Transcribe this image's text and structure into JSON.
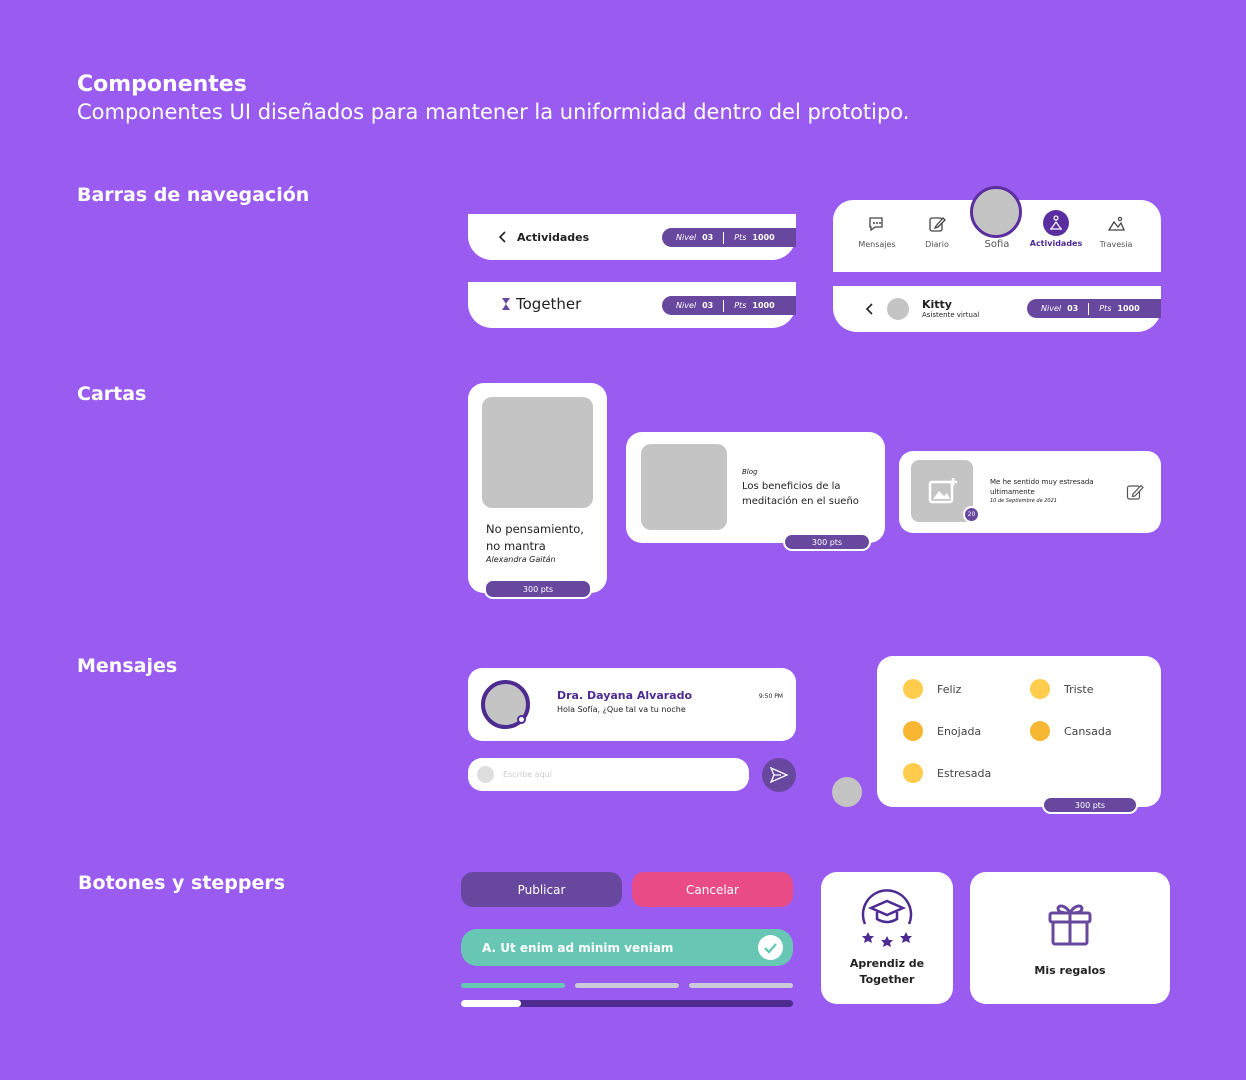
{
  "header": {
    "title": "Componentes",
    "subtitle": "Componentes UI diseñados para mantener la uniformidad dentro del prototipo."
  },
  "sections": {
    "nav": "Barras de navegación",
    "cards": "Cartas",
    "messages": "Mensajes",
    "buttons": "Botones y steppers"
  },
  "navbar_activities": {
    "title": "Actividades",
    "level_label": "Nivel",
    "level_value": "03",
    "pts_label": "Pts",
    "pts_value": "1000"
  },
  "navbar_together": {
    "title": "Together",
    "level_label": "Nivel",
    "level_value": "03",
    "pts_label": "Pts",
    "pts_value": "1000"
  },
  "tabbar": {
    "tabs": [
      {
        "label": "Mensajes",
        "icon": "chat-icon"
      },
      {
        "label": "Diario",
        "icon": "edit-icon"
      },
      {
        "label": "Sofia",
        "icon": "avatar"
      },
      {
        "label": "Actividades",
        "icon": "meditation-icon"
      },
      {
        "label": "Travesia",
        "icon": "journey-icon"
      }
    ],
    "active": "Actividades"
  },
  "chatbar": {
    "name": "Kitty",
    "role": "Asistente virtual",
    "level_label": "Nivel",
    "level_value": "03",
    "pts_label": "Pts",
    "pts_value": "1000"
  },
  "cards": {
    "card1": {
      "title": "No pensamiento, no mantra",
      "author": "Alexandra Gaitán",
      "pts": "300 pts"
    },
    "card2": {
      "category": "Blog",
      "title": "Los beneficios de la meditación en el sueño",
      "pts": "300 pts"
    },
    "card3": {
      "text": "Me he sentido muy estresada ultimamente",
      "date": "10 de Septiembre de 2021",
      "badge": "20"
    }
  },
  "message": {
    "sender": "Dra. Dayana Alvarado",
    "time": "9:50 PM",
    "preview": "Hola Sofía, ¿Que tal va tu noche"
  },
  "composer": {
    "placeholder": "Escribe aquí"
  },
  "moods": {
    "items": [
      {
        "label": "Feliz"
      },
      {
        "label": "Triste"
      },
      {
        "label": "Enojada"
      },
      {
        "label": "Cansada"
      },
      {
        "label": "Estresada"
      }
    ],
    "pts": "300 pts"
  },
  "buttons": {
    "publish": "Publicar",
    "cancel": "Cancelar",
    "answer": "A. Ut enim ad minim veniam"
  },
  "stepper": {
    "progress": 0.18
  },
  "tiles": {
    "learn": "Aprendiz de Together",
    "gifts": "Mis regalos"
  },
  "colors": {
    "background": "#9a5cf0",
    "primary": "#67489e",
    "danger": "#e94b86",
    "success": "#67c7b4"
  }
}
